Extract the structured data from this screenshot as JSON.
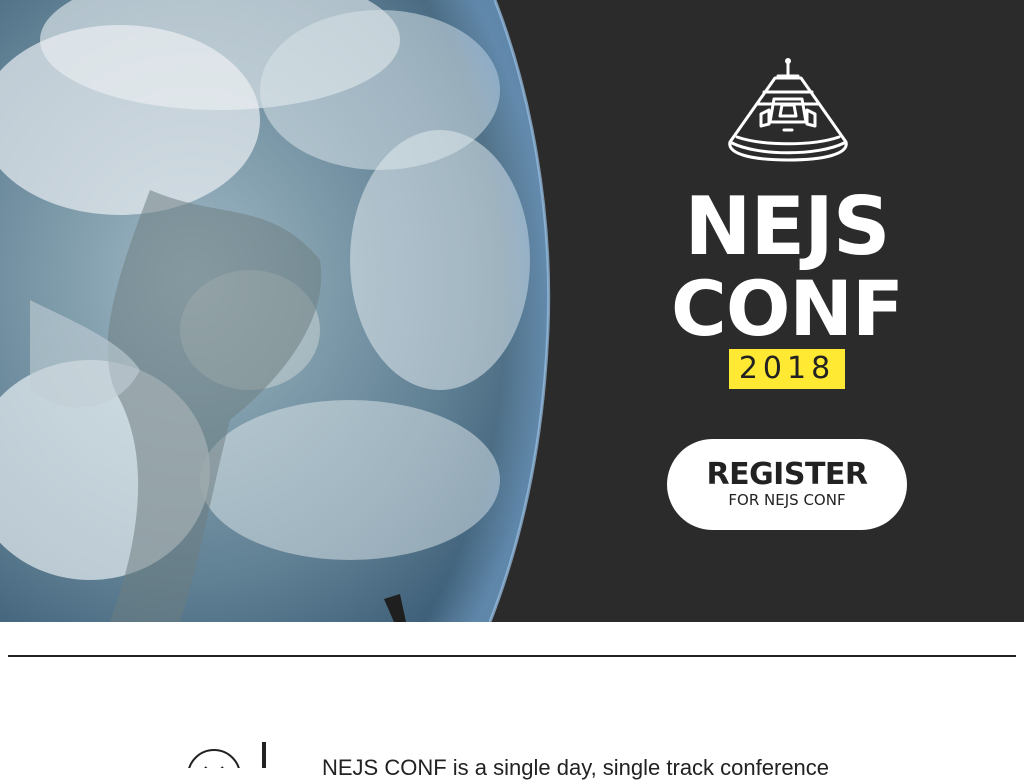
{
  "hero": {
    "title_line1": "NEJS",
    "title_line2": "CONF",
    "year": "2018",
    "register_label": "REGISTER",
    "register_sublabel": "FOR NEJS CONF"
  },
  "about": {
    "text": "NEJS CONF is a single day, single track conference"
  },
  "colors": {
    "hero_background": "#2b2b2b",
    "year_badge": "#ffe932",
    "text_dark": "#222222",
    "white": "#ffffff"
  },
  "icons": {
    "logo": "space-capsule-icon",
    "about": "clock-icon"
  }
}
